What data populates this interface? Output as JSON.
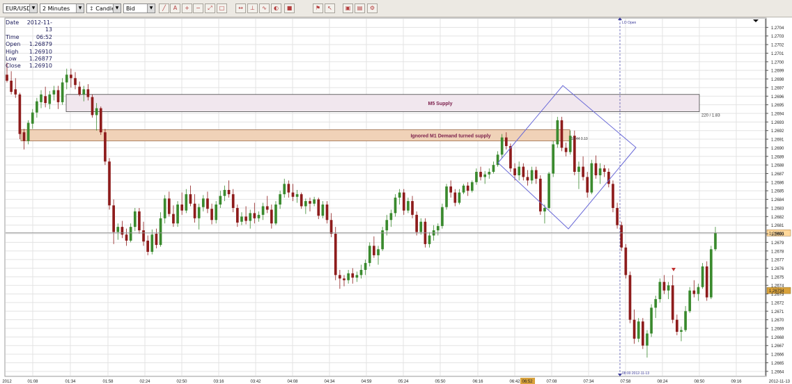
{
  "toolbar": {
    "symbol": "EUR/USD",
    "timeframe": "2 Minutes",
    "chart_style": "Candle",
    "price_side": "Bid",
    "buttons": [
      "draw-line-icon",
      "text-icon",
      "zoom-in-icon",
      "zoom-out-icon",
      "zoom-fit-icon",
      "zoom-reset-icon",
      "arrows-icon",
      "axis-icon",
      "indicator-icon",
      "palette-icon",
      "square-icon",
      "alert-icon",
      "cursor-icon",
      "window-icon",
      "save-icon",
      "settings-icon"
    ]
  },
  "info_box": {
    "date_label": "Date",
    "date_value": "2012-11-13",
    "time_label": "Time",
    "time_value": "06:52",
    "open_label": "Open",
    "open_value": "1.26879",
    "high_label": "High",
    "high_value": "1.26910",
    "low_label": "Low",
    "low_value": "1.26877",
    "close_label": "Close",
    "close_value": "1.26910"
  },
  "colors": {
    "bull": "#3a8a2e",
    "bear": "#8e1c1c",
    "grid": "#e3e3e3",
    "supply_zone": "#f1e7ee",
    "demand_zone": "#f0d2b8",
    "pattern_line": "#6a6ad8",
    "current_price_line": "#8f8f8f",
    "current_price_tag": "#ffd89a",
    "marker_tag": "#d9a23c"
  },
  "annotations": {
    "m5_supply": "M5 Supply",
    "ignored_demand": "Ignored M1 Demand turned supply",
    "ratio_label": "220 / 1.83",
    "lo_open": "LO Open",
    "lo_open_time": "08:00 2012-11-13",
    "small_label": "10:44 0.10"
  },
  "chart_data": {
    "type": "candlestick",
    "title": "",
    "symbol": "EUR/USD",
    "timeframe": "2 Minutes",
    "date": "2012-11-13",
    "ylim": [
      1.26635,
      1.2705
    ],
    "current_price": 1.26801,
    "marked_price": 1.26734,
    "y_ticks": [
      "1.2704",
      "1.2703",
      "1.2702",
      "1.2701",
      "1.2700",
      "1.2699",
      "1.2698",
      "1.2697",
      "1.2696",
      "1.2695",
      "1.2694",
      "1.2693",
      "1.2692",
      "1.2691",
      "1.2690",
      "1.2689",
      "1.2688",
      "1.2687",
      "1.2686",
      "1.2685",
      "1.2684",
      "1.2683",
      "1.2682",
      "1.2681",
      "1.2680",
      "1.2679",
      "1.2678",
      "1.2677",
      "1.2676",
      "1.2675",
      "1.2674",
      "1.2673",
      "1.2672",
      "1.2671",
      "1.2670",
      "1.2669",
      "1.2668",
      "1.2667",
      "1.2666",
      "1.2665",
      "1.2664"
    ],
    "current_price_label": "1.26801",
    "marked_price_label": "1.26734",
    "x_ticks": [
      "2012",
      "01:08",
      "01:34",
      "01:58",
      "02:24",
      "02:50",
      "03:16",
      "03:42",
      "04:08",
      "04:34",
      "04:59",
      "05:24",
      "05:50",
      "06:16",
      "06:42",
      "06:52",
      "07:08",
      "07:34",
      "07:58",
      "08:24",
      "08:50",
      "09:16",
      "2012-11-13"
    ],
    "supply_zone": {
      "label": "M5 Supply",
      "top": 1.26962,
      "bottom": 1.26942
    },
    "demand_zone": {
      "label": "Ignored M1 Demand turned supply",
      "top": 1.26921,
      "bottom": 1.26908
    },
    "vertical_marker": {
      "label": "LO Open",
      "time": "08:00 2012-11-13"
    },
    "candles": [
      [
        1.26985,
        1.26999,
        1.26976,
        1.26978
      ],
      [
        1.26978,
        1.26989,
        1.26962,
        1.26965
      ],
      [
        1.26968,
        1.26981,
        1.26958,
        1.26962
      ],
      [
        1.26962,
        1.26964,
        1.2691,
        1.26916
      ],
      [
        1.26918,
        1.26922,
        1.26898,
        1.26908
      ],
      [
        1.26908,
        1.26932,
        1.26904,
        1.26929
      ],
      [
        1.26928,
        1.26945,
        1.26922,
        1.26941
      ],
      [
        1.26941,
        1.26958,
        1.26935,
        1.26954
      ],
      [
        1.26953,
        1.26967,
        1.26946,
        1.26962
      ],
      [
        1.2696,
        1.26971,
        1.26947,
        1.26952
      ],
      [
        1.26951,
        1.26966,
        1.26945,
        1.26962
      ],
      [
        1.26962,
        1.26972,
        1.26955,
        1.26967
      ],
      [
        1.26967,
        1.26972,
        1.26945,
        1.26953
      ],
      [
        1.26953,
        1.26981,
        1.2695,
        1.26976
      ],
      [
        1.26976,
        1.26992,
        1.26968,
        1.26985
      ],
      [
        1.26985,
        1.26992,
        1.2697,
        1.26981
      ],
      [
        1.26981,
        1.26988,
        1.26968,
        1.26973
      ],
      [
        1.26971,
        1.26977,
        1.2696,
        1.26962
      ],
      [
        1.26962,
        1.26972,
        1.26954,
        1.26968
      ],
      [
        1.26968,
        1.26974,
        1.26955,
        1.26959
      ],
      [
        1.26959,
        1.26962,
        1.26935,
        1.26938
      ],
      [
        1.26938,
        1.26952,
        1.2692,
        1.26946
      ],
      [
        1.26946,
        1.26948,
        1.26915,
        1.26918
      ],
      [
        1.26918,
        1.26922,
        1.2688,
        1.26884
      ],
      [
        1.26884,
        1.26888,
        1.26828,
        1.26833
      ],
      [
        1.26833,
        1.2684,
        1.26788,
        1.26802
      ],
      [
        1.26802,
        1.26812,
        1.26793,
        1.26808
      ],
      [
        1.26808,
        1.26815,
        1.26795,
        1.26799
      ],
      [
        1.26799,
        1.26806,
        1.26786,
        1.26792
      ],
      [
        1.26792,
        1.26812,
        1.2679,
        1.26808
      ],
      [
        1.26808,
        1.2683,
        1.26803,
        1.26826
      ],
      [
        1.26826,
        1.2683,
        1.268,
        1.26804
      ],
      [
        1.26804,
        1.26814,
        1.26786,
        1.26791
      ],
      [
        1.26792,
        1.26798,
        1.26775,
        1.26779
      ],
      [
        1.26779,
        1.26805,
        1.26776,
        1.26799
      ],
      [
        1.268,
        1.26806,
        1.26783,
        1.26787
      ],
      [
        1.26787,
        1.26825,
        1.26785,
        1.26818
      ],
      [
        1.26818,
        1.26845,
        1.26812,
        1.26841
      ],
      [
        1.26841,
        1.26849,
        1.2682,
        1.26823
      ],
      [
        1.26823,
        1.26833,
        1.26808,
        1.26812
      ],
      [
        1.26812,
        1.26838,
        1.26808,
        1.26834
      ],
      [
        1.26834,
        1.26848,
        1.26822,
        1.26827
      ],
      [
        1.26827,
        1.26852,
        1.26824,
        1.26846
      ],
      [
        1.26846,
        1.26856,
        1.26832,
        1.26835
      ],
      [
        1.26835,
        1.26846,
        1.26813,
        1.26818
      ],
      [
        1.26818,
        1.26835,
        1.26805,
        1.26831
      ],
      [
        1.26831,
        1.26845,
        1.26826,
        1.26841
      ],
      [
        1.26841,
        1.26849,
        1.26824,
        1.26829
      ],
      [
        1.26829,
        1.26835,
        1.26811,
        1.26816
      ],
      [
        1.26816,
        1.26838,
        1.26812,
        1.26834
      ],
      [
        1.26834,
        1.2685,
        1.2683,
        1.26844
      ],
      [
        1.26844,
        1.26856,
        1.26838,
        1.26851
      ],
      [
        1.26851,
        1.26862,
        1.26842,
        1.26846
      ],
      [
        1.26846,
        1.26852,
        1.26825,
        1.2683
      ],
      [
        1.2683,
        1.26834,
        1.26808,
        1.26813
      ],
      [
        1.26814,
        1.26825,
        1.2681,
        1.2682
      ],
      [
        1.2682,
        1.26832,
        1.26811,
        1.26815
      ],
      [
        1.26815,
        1.26828,
        1.26806,
        1.26824
      ],
      [
        1.26824,
        1.26836,
        1.26812,
        1.26818
      ],
      [
        1.26818,
        1.26826,
        1.26814,
        1.26822
      ],
      [
        1.26822,
        1.26836,
        1.26816,
        1.26832
      ],
      [
        1.26832,
        1.26844,
        1.26824,
        1.26828
      ],
      [
        1.26828,
        1.26834,
        1.26806,
        1.26812
      ],
      [
        1.26812,
        1.26838,
        1.2681,
        1.26834
      ],
      [
        1.26834,
        1.2685,
        1.26829,
        1.26846
      ],
      [
        1.26846,
        1.26864,
        1.26842,
        1.26858
      ],
      [
        1.26858,
        1.26862,
        1.26842,
        1.26848
      ],
      [
        1.26848,
        1.26858,
        1.26838,
        1.26843
      ],
      [
        1.26843,
        1.26851,
        1.26836,
        1.26846
      ],
      [
        1.26846,
        1.26848,
        1.26829,
        1.26832
      ],
      [
        1.26832,
        1.26841,
        1.26823,
        1.26838
      ],
      [
        1.26838,
        1.26842,
        1.26826,
        1.26835
      ],
      [
        1.26835,
        1.26843,
        1.26832,
        1.2684
      ],
      [
        1.2684,
        1.26842,
        1.26817,
        1.26821
      ],
      [
        1.26821,
        1.26838,
        1.26818,
        1.26834
      ],
      [
        1.26834,
        1.26838,
        1.26812,
        1.26816
      ],
      [
        1.26816,
        1.26824,
        1.26796,
        1.268
      ],
      [
        1.268,
        1.26808,
        1.26746,
        1.26752
      ],
      [
        1.26752,
        1.26758,
        1.26736,
        1.26748
      ],
      [
        1.26748,
        1.26752,
        1.26739,
        1.26746
      ],
      [
        1.26746,
        1.26758,
        1.26742,
        1.26754
      ],
      [
        1.26754,
        1.2676,
        1.26742,
        1.26749
      ],
      [
        1.26749,
        1.26756,
        1.26744,
        1.26752
      ],
      [
        1.26752,
        1.26764,
        1.26748,
        1.26758
      ],
      [
        1.26758,
        1.2677,
        1.26752,
        1.26766
      ],
      [
        1.26766,
        1.2679,
        1.26762,
        1.26786
      ],
      [
        1.26786,
        1.26797,
        1.26772,
        1.26775
      ],
      [
        1.26775,
        1.26786,
        1.26764,
        1.26782
      ],
      [
        1.26782,
        1.26808,
        1.2678,
        1.26804
      ],
      [
        1.26804,
        1.26822,
        1.26798,
        1.26816
      ],
      [
        1.26816,
        1.26828,
        1.26808,
        1.26824
      ],
      [
        1.26824,
        1.26846,
        1.2682,
        1.26842
      ],
      [
        1.26842,
        1.26852,
        1.26834,
        1.26848
      ],
      [
        1.26848,
        1.26852,
        1.26822,
        1.26827
      ],
      [
        1.26827,
        1.26842,
        1.26824,
        1.26838
      ],
      [
        1.26838,
        1.26844,
        1.26818,
        1.26822
      ],
      [
        1.26822,
        1.26826,
        1.26798,
        1.26802
      ],
      [
        1.26802,
        1.26818,
        1.26799,
        1.26814
      ],
      [
        1.26814,
        1.26818,
        1.26784,
        1.26788
      ],
      [
        1.26788,
        1.26802,
        1.26784,
        1.26798
      ],
      [
        1.26798,
        1.2681,
        1.26792,
        1.26804
      ],
      [
        1.26804,
        1.26812,
        1.26798,
        1.26809
      ],
      [
        1.26809,
        1.26835,
        1.26806,
        1.26831
      ],
      [
        1.26831,
        1.26858,
        1.26828,
        1.26855
      ],
      [
        1.26855,
        1.26862,
        1.26842,
        1.26848
      ],
      [
        1.26848,
        1.26852,
        1.26832,
        1.26836
      ],
      [
        1.26836,
        1.26852,
        1.26834,
        1.26848
      ],
      [
        1.26848,
        1.26858,
        1.26846,
        1.26856
      ],
      [
        1.26856,
        1.2686,
        1.26844,
        1.2685
      ],
      [
        1.2685,
        1.26862,
        1.26848,
        1.2686
      ],
      [
        1.2686,
        1.26876,
        1.26857,
        1.26872
      ],
      [
        1.26872,
        1.26878,
        1.26862,
        1.26866
      ],
      [
        1.26866,
        1.26873,
        1.26858,
        1.26869
      ],
      [
        1.26869,
        1.26876,
        1.26864,
        1.26872
      ],
      [
        1.26872,
        1.26884,
        1.2687,
        1.2688
      ],
      [
        1.2688,
        1.26896,
        1.26878,
        1.26892
      ],
      [
        1.26892,
        1.26916,
        1.26888,
        1.26912
      ],
      [
        1.26912,
        1.26918,
        1.26898,
        1.26902
      ],
      [
        1.26902,
        1.26905,
        1.26872,
        1.26876
      ],
      [
        1.26876,
        1.26882,
        1.26862,
        1.26868
      ],
      [
        1.26868,
        1.26884,
        1.26862,
        1.26878
      ],
      [
        1.26878,
        1.26882,
        1.26862,
        1.26866
      ],
      [
        1.26866,
        1.26874,
        1.26856,
        1.26862
      ],
      [
        1.26862,
        1.26878,
        1.26858,
        1.26874
      ],
      [
        1.26874,
        1.26878,
        1.26858,
        1.26864
      ],
      [
        1.26864,
        1.26868,
        1.26822,
        1.26826
      ],
      [
        1.26826,
        1.26834,
        1.26812,
        1.2683
      ],
      [
        1.2683,
        1.26872,
        1.26828,
        1.2687
      ],
      [
        1.2687,
        1.26908,
        1.26866,
        1.26904
      ],
      [
        1.26904,
        1.26936,
        1.269,
        1.26932
      ],
      [
        1.26932,
        1.26936,
        1.26896,
        1.269
      ],
      [
        1.269,
        1.26906,
        1.2689,
        1.26895
      ],
      [
        1.26895,
        1.2692,
        1.26892,
        1.26914
      ],
      [
        1.26914,
        1.2692,
        1.26868,
        1.26872
      ],
      [
        1.26872,
        1.26884,
        1.26852,
        1.26878
      ],
      [
        1.26878,
        1.2689,
        1.26862,
        1.26866
      ],
      [
        1.26866,
        1.26872,
        1.26842,
        1.26848
      ],
      [
        1.26848,
        1.26886,
        1.26846,
        1.26882
      ],
      [
        1.26882,
        1.26891,
        1.26864,
        1.26868
      ],
      [
        1.26868,
        1.26882,
        1.26858,
        1.26876
      ],
      [
        1.26876,
        1.2688,
        1.26866,
        1.26872
      ],
      [
        1.26872,
        1.26876,
        1.26854,
        1.26858
      ],
      [
        1.26858,
        1.26862,
        1.26825,
        1.2683
      ],
      [
        1.2683,
        1.26836,
        1.26806,
        1.2681
      ],
      [
        1.2681,
        1.26814,
        1.2678,
        1.26784
      ],
      [
        1.26784,
        1.26788,
        1.26748,
        1.26752
      ],
      [
        1.26752,
        1.26756,
        1.26696,
        1.267
      ],
      [
        1.267,
        1.26712,
        1.26672,
        1.26678
      ],
      [
        1.26678,
        1.26702,
        1.26674,
        1.26698
      ],
      [
        1.26698,
        1.26702,
        1.26666,
        1.2667
      ],
      [
        1.2667,
        1.26688,
        1.26656,
        1.26684
      ],
      [
        1.26684,
        1.26718,
        1.2668,
        1.26714
      ],
      [
        1.26714,
        1.26728,
        1.26702,
        1.26724
      ],
      [
        1.26724,
        1.26748,
        1.2672,
        1.26744
      ],
      [
        1.26744,
        1.26752,
        1.2673,
        1.26734
      ],
      [
        1.26734,
        1.26744,
        1.26724,
        1.2674
      ],
      [
        1.2674,
        1.26752,
        1.26696,
        1.267
      ],
      [
        1.267,
        1.26706,
        1.26682,
        1.26686
      ],
      [
        1.26686,
        1.26692,
        1.26675,
        1.26688
      ],
      [
        1.26688,
        1.26716,
        1.26686,
        1.2671
      ],
      [
        1.2671,
        1.26738,
        1.26708,
        1.26734
      ],
      [
        1.26734,
        1.26746,
        1.26726,
        1.2673
      ],
      [
        1.2673,
        1.26742,
        1.26722,
        1.26738
      ],
      [
        1.26738,
        1.26766,
        1.26736,
        1.26762
      ],
      [
        1.26762,
        1.26768,
        1.26722,
        1.26726
      ],
      [
        1.26726,
        1.26786,
        1.26724,
        1.26782
      ],
      [
        1.26782,
        1.26808,
        1.2678,
        1.26801
      ]
    ]
  }
}
